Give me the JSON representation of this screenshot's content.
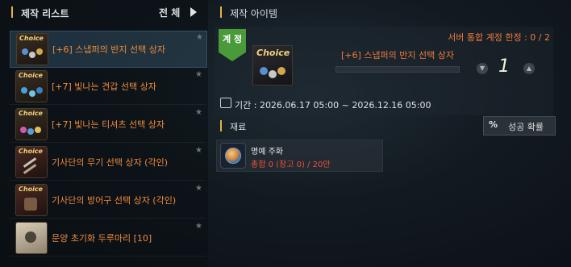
{
  "left_panel": {
    "title": "제작 리스트",
    "filter_label": "전 체",
    "items": [
      {
        "label": "[+6] 스냅퍼의 반지 선택 상자",
        "badge": "Choice",
        "selected": true
      },
      {
        "label": "[+7] 빛나는 견갑 선택 상자",
        "badge": "Choice",
        "selected": false
      },
      {
        "label": "[+7] 빛나는 티셔츠 선택 상자",
        "badge": "Choice",
        "selected": false
      },
      {
        "label": "기사단의 무기 선택 상자 (각인)",
        "badge": "Choice",
        "selected": false
      },
      {
        "label": "기사단의 방어구 선택 상자 (각인)",
        "badge": "Choice",
        "selected": false
      },
      {
        "label": "문양 초기화 두루마리 [10]",
        "badge": "",
        "selected": false
      }
    ]
  },
  "right_panel": {
    "title": "제작 아이템",
    "grade_label": "계 정",
    "server_limit": "서버 통합 계정 한정 : 0 / 2",
    "item_name": "[+6] 스냅퍼의 반지 선택 상자",
    "item_badge": "Choice",
    "quantity": "1",
    "decrease_icon": "chevron-down-icon",
    "increase_icon": "chevron-up-icon",
    "period": "기간 : 2026.06.17 05:00 ~ 2026.12.16 05:00",
    "materials_title": "재료",
    "success_rate_symbol": "%",
    "success_rate_label": "성공 확률",
    "material": {
      "name": "명예 주화",
      "count": "총합 0 (창고 0) / 20만"
    }
  },
  "colors": {
    "accent": "#e8b04a",
    "item_text": "#f08a3a",
    "warning": "#ef4e3a",
    "grade": "#4a9a3a"
  }
}
